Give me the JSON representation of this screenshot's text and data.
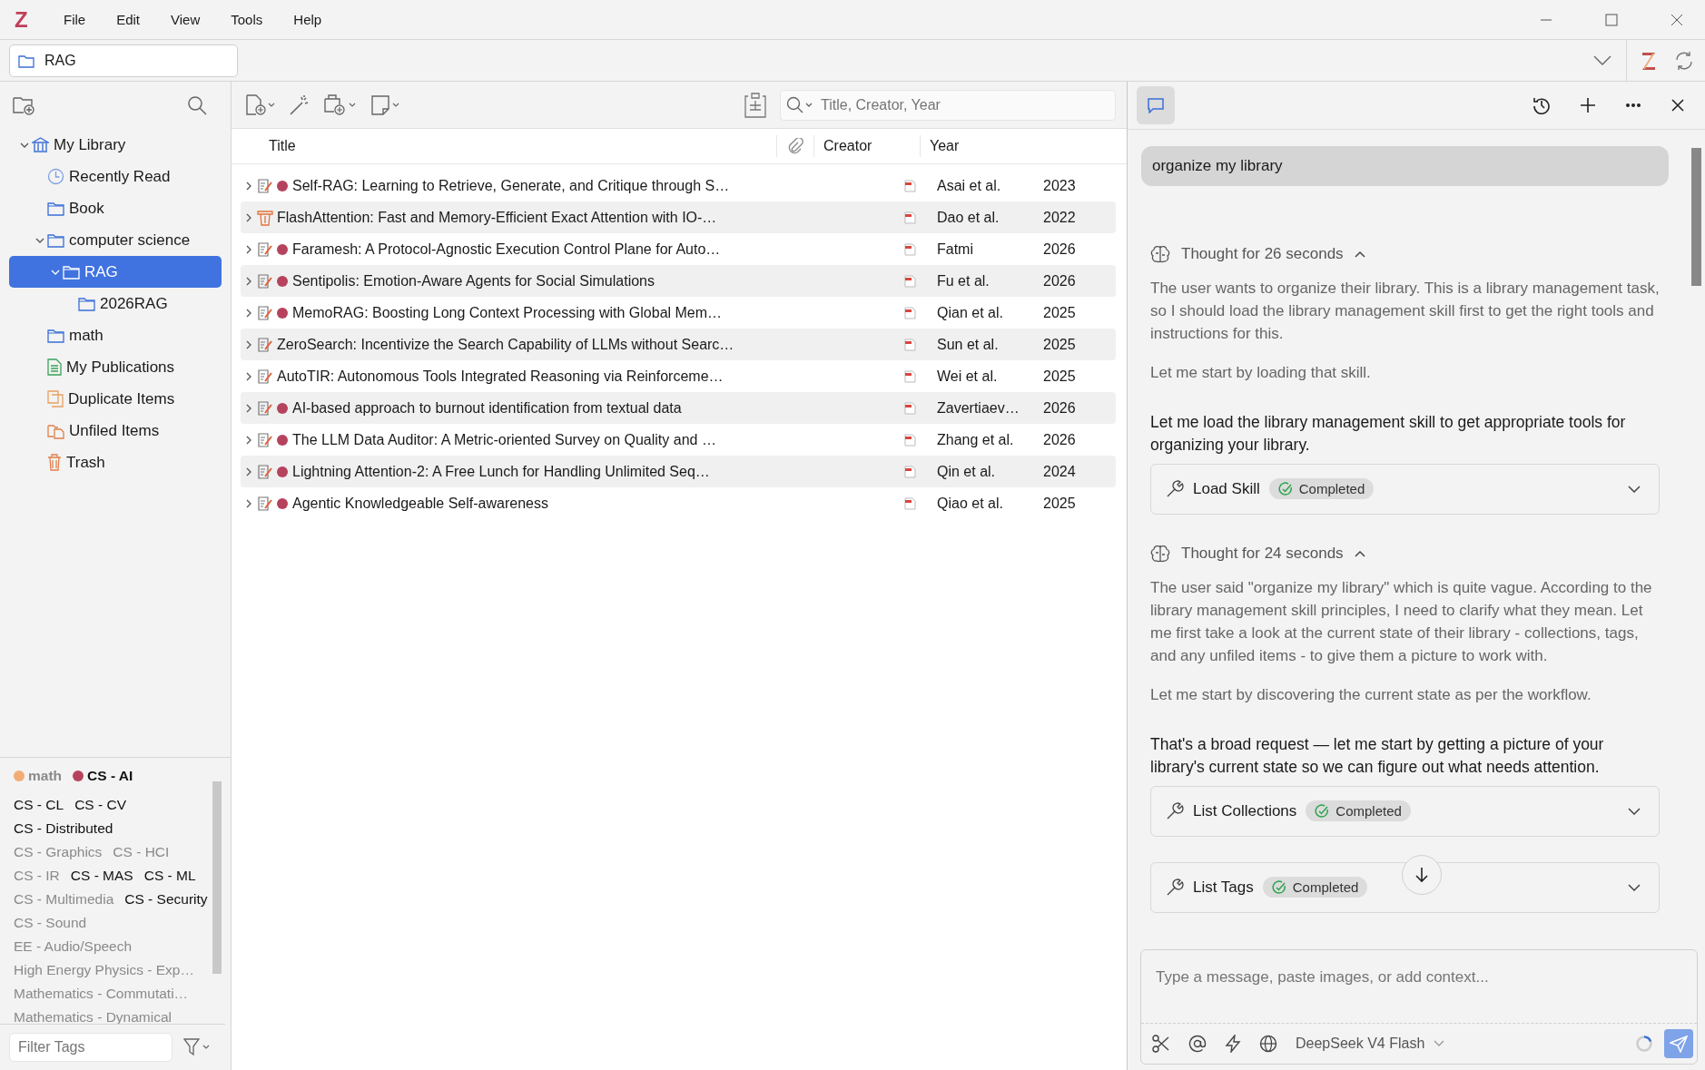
{
  "app_logo": "Z",
  "menu": [
    "File",
    "Edit",
    "View",
    "Tools",
    "Help"
  ],
  "location": {
    "label": "RAG"
  },
  "collections": [
    {
      "label": "My Library",
      "kind": "library",
      "expanded": true,
      "selected": false,
      "children": [
        {
          "label": "Recently Read",
          "kind": "clock",
          "selected": false
        },
        {
          "label": "Book",
          "kind": "folder",
          "selected": false
        },
        {
          "label": "computer science",
          "kind": "folder",
          "expanded": true,
          "selected": false,
          "children": [
            {
              "label": "RAG",
              "kind": "folder",
              "expanded": true,
              "selected": true,
              "children": [
                {
                  "label": "2026RAG",
                  "kind": "folder",
                  "selected": false
                }
              ]
            }
          ]
        },
        {
          "label": "math",
          "kind": "folder",
          "selected": false
        },
        {
          "label": "My Publications",
          "kind": "publications",
          "selected": false
        },
        {
          "label": "Duplicate Items",
          "kind": "duplicates",
          "selected": false
        },
        {
          "label": "Unfiled Items",
          "kind": "unfiled",
          "selected": false
        },
        {
          "label": "Trash",
          "kind": "trash",
          "selected": false
        }
      ]
    }
  ],
  "tags": [
    {
      "label": "math",
      "color": "#f0ad78",
      "enabled": false
    },
    {
      "label": "CS - AI",
      "color": "#b5435e",
      "enabled": true
    },
    {
      "label": "CS - CL",
      "enabled": true
    },
    {
      "label": "CS - CV",
      "enabled": true
    },
    {
      "label": "CS - Distributed",
      "enabled": true
    },
    {
      "label": "CS - Graphics",
      "enabled": false
    },
    {
      "label": "CS - HCI",
      "enabled": false
    },
    {
      "label": "CS - IR",
      "enabled": false
    },
    {
      "label": "CS - MAS",
      "enabled": true
    },
    {
      "label": "CS - ML",
      "enabled": true
    },
    {
      "label": "CS - Multimedia",
      "enabled": false
    },
    {
      "label": "CS - Security",
      "enabled": true
    },
    {
      "label": "CS - Sound",
      "enabled": false
    },
    {
      "label": "EE - Audio/Speech",
      "enabled": false
    },
    {
      "label": "High Energy Physics - Exp…",
      "enabled": false
    },
    {
      "label": "Mathematics - Commutati…",
      "enabled": false
    },
    {
      "label": "Mathematics - Dynamical",
      "enabled": false
    }
  ],
  "tag_filter": {
    "placeholder": "Filter Tags"
  },
  "search": {
    "placeholder": "Title, Creator, Year"
  },
  "table": {
    "columns": [
      "Title",
      "Creator",
      "Year"
    ],
    "rows": [
      {
        "kind": "preprint",
        "color": "#b5435e",
        "title": "Self-RAG: Learning to Retrieve, Generate, and Critique through S…",
        "creator": "Asai et al.",
        "year": "2023"
      },
      {
        "kind": "conference",
        "title": "FlashAttention: Fast and Memory-Efficient Exact Attention with IO-…",
        "creator": "Dao et al.",
        "year": "2022"
      },
      {
        "kind": "preprint",
        "color": "#b5435e",
        "title": "Faramesh: A Protocol-Agnostic Execution Control Plane for Auto…",
        "creator": "Fatmi",
        "year": "2026"
      },
      {
        "kind": "preprint",
        "color": "#b5435e",
        "title": "Sentipolis: Emotion-Aware Agents for Social Simulations",
        "creator": "Fu et al.",
        "year": "2026"
      },
      {
        "kind": "preprint",
        "color": "#b5435e",
        "title": "MemoRAG: Boosting Long Context Processing with Global Mem…",
        "creator": "Qian et al.",
        "year": "2025"
      },
      {
        "kind": "preprint",
        "title": "ZeroSearch: Incentivize the Search Capability of LLMs without Searc…",
        "creator": "Sun et al.",
        "year": "2025"
      },
      {
        "kind": "preprint",
        "title": "AutoTIR: Autonomous Tools Integrated Reasoning via Reinforceme…",
        "creator": "Wei et al.",
        "year": "2025"
      },
      {
        "kind": "preprint",
        "color": "#b5435e",
        "title": "AI-based approach to burnout identification from textual data",
        "creator": "Zavertiaev…",
        "year": "2026"
      },
      {
        "kind": "preprint",
        "color": "#b5435e",
        "title": "The LLM Data Auditor: A Metric-oriented Survey on Quality and …",
        "creator": "Zhang et al.",
        "year": "2026"
      },
      {
        "kind": "preprint",
        "color": "#b5435e",
        "title": "Lightning Attention-2: A Free Lunch for Handling Unlimited Seq…",
        "creator": "Qin et al.",
        "year": "2024"
      },
      {
        "kind": "preprint",
        "color": "#b5435e",
        "title": "Agentic Knowledgeable Self-awareness",
        "creator": "Qiao et al.",
        "year": "2025"
      }
    ]
  },
  "chat": {
    "messages": [
      {
        "kind": "user",
        "text": "organize my library"
      },
      {
        "kind": "thought",
        "label": "Thought for 26 seconds",
        "expanded": true,
        "paragraphs": [
          "The user wants to organize their library. This is a library management task, so I should load the library management skill first to get the right tools and instructions for this.",
          "Let me start by loading that skill."
        ]
      },
      {
        "kind": "text",
        "text": "Let me load the library management skill to get appropriate tools for organizing your library."
      },
      {
        "kind": "tool",
        "name": "Load Skill",
        "status": "Completed"
      },
      {
        "kind": "thought",
        "label": "Thought for 24 seconds",
        "expanded": true,
        "paragraphs": [
          "The user said \"organize my library\" which is quite vague. According to the library management skill principles, I need to clarify what they mean. Let me first take a look at the current state of their library - collections, tags, and any unfiled items - to give them a picture to work with.",
          "Let me start by discovering the current state as per the workflow."
        ]
      },
      {
        "kind": "text",
        "text": "That's a broad request — let me start by getting a picture of your library's current state so we can figure out what needs attention."
      },
      {
        "kind": "tool",
        "name": "List Collections",
        "status": "Completed"
      },
      {
        "kind": "tool",
        "name": "List Tags",
        "status": "Completed"
      }
    ],
    "input": {
      "placeholder": "Type a message, paste images, or add context..."
    },
    "model": "DeepSeek V4 Flash"
  }
}
